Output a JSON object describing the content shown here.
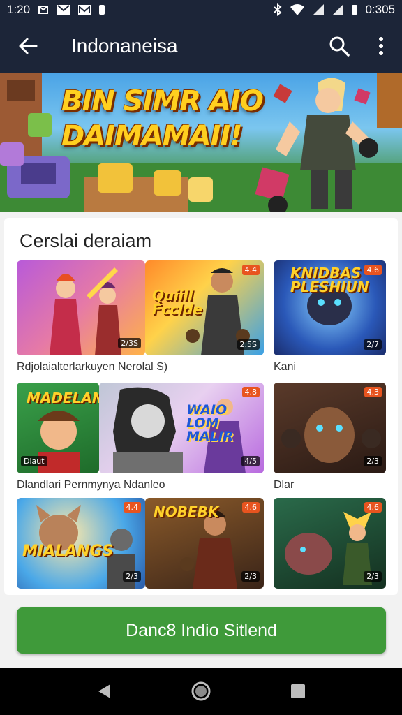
{
  "status_bar": {
    "time": "1:20",
    "right_time": "0:305",
    "icons_left": [
      "settings-icon",
      "gmail-icon",
      "gmail-icon",
      "battery-icon"
    ],
    "icons_right": [
      "bluetooth-icon",
      "wifi-icon",
      "signal-icon",
      "signal-icon",
      "battery-icon"
    ]
  },
  "app_bar": {
    "title": "Indonaneisa",
    "back_icon": "arrow-left-icon",
    "search_icon": "search-icon",
    "more_icon": "more-vert-icon"
  },
  "banner": {
    "headline_line1": "BIN SIMR AIO",
    "headline_line2": "DAIMAMAII!"
  },
  "section": {
    "title": "Cerslai deraiam"
  },
  "tiles": [
    {
      "badge": "2/3S",
      "label": ""
    },
    {
      "badge": "2.5S",
      "label": "Quiill Fcclde"
    },
    {
      "badge": "2/7",
      "label": "KNIDBAS PLESHIUN"
    },
    {
      "badge": "",
      "label": "MADELAN"
    },
    {
      "badge": "4/5",
      "label": "WAIO LOM MALIR"
    },
    {
      "badge": "2/3",
      "label": ""
    },
    {
      "badge": "2/3",
      "label": "MIALANGS"
    },
    {
      "badge": "2/3",
      "label": "NOBEBK"
    },
    {
      "badge": "2/3",
      "label": ""
    }
  ],
  "captions": {
    "row1_left": "Rdjolaialterlarkuyen Nerolal S)",
    "row1_right": "Kani",
    "row2_left": "Dlandlari Pernmynya Ndanleo",
    "row2_right": "Dlar",
    "row2_tile_left": "Dlaut"
  },
  "cta": {
    "label": "Danc8 Indio Sitlend"
  },
  "nav": {
    "back": "nav-back-icon",
    "home": "nav-home-icon",
    "recents": "nav-recents-icon"
  },
  "colors": {
    "app_bar": "#1c2538",
    "cta": "#3f9a3a",
    "headline": "#ffcf1f"
  }
}
